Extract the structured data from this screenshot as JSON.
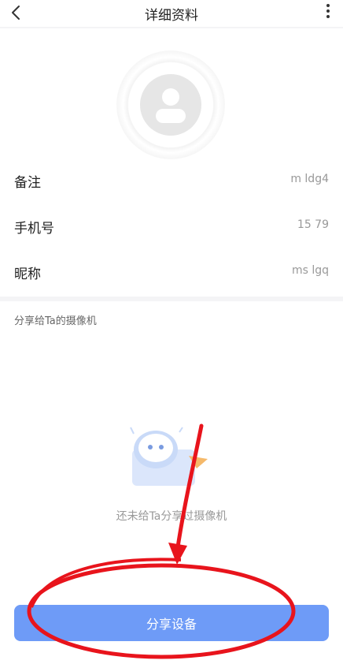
{
  "header": {
    "title": "详细资料",
    "back_icon": "chevron-left-icon",
    "more_icon": "more-vertical-icon"
  },
  "profile": {
    "avatar_icon": "user-avatar-icon",
    "rows": [
      {
        "label": "备注",
        "value": "m ldg4"
      },
      {
        "label": "手机号",
        "value": "15  79"
      },
      {
        "label": "昵称",
        "value": "ms lgq"
      }
    ]
  },
  "share": {
    "section_title": "分享给Ta的摄像机",
    "empty_text": "还未给Ta分享过摄像机",
    "button_label": "分享设备"
  },
  "colors": {
    "primary_button": "#6e9bf7",
    "annotation_red": "#e8141c"
  }
}
